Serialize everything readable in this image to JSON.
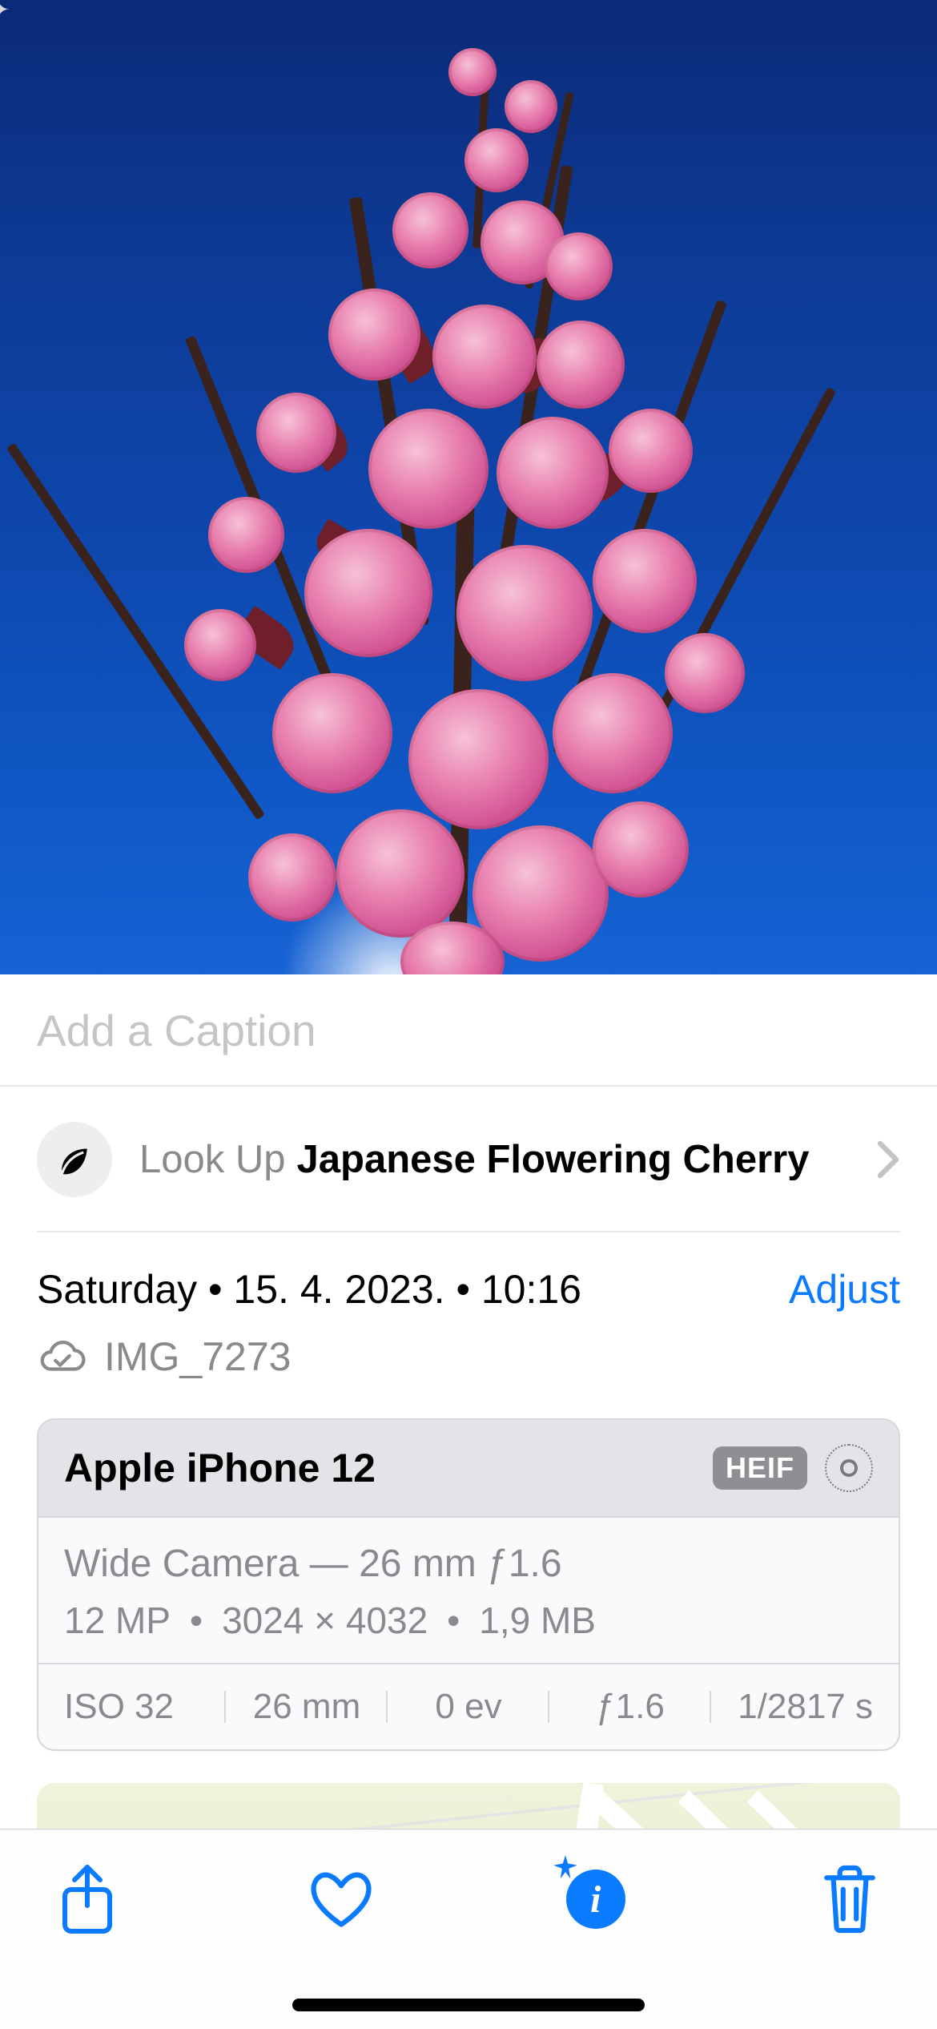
{
  "caption": {
    "placeholder": "Add a Caption",
    "value": ""
  },
  "lookup": {
    "prefix": "Look Up",
    "subject": "Japanese Flowering Cherry"
  },
  "meta": {
    "day": "Saturday",
    "date": "15. 4. 2023.",
    "time": "10:16",
    "adjust_label": "Adjust",
    "filename": "IMG_7273"
  },
  "camera": {
    "device": "Apple iPhone 12",
    "format_badge": "HEIF",
    "lens_line": "Wide Camera — 26 mm ƒ1.6",
    "megapixels": "12 MP",
    "dimensions": "3024 × 4032",
    "filesize": "1,9 MB",
    "exif": {
      "iso": "ISO 32",
      "focal": "26 mm",
      "ev": "0 ev",
      "aperture": "ƒ1.6",
      "shutter": "1/2817 s"
    }
  }
}
